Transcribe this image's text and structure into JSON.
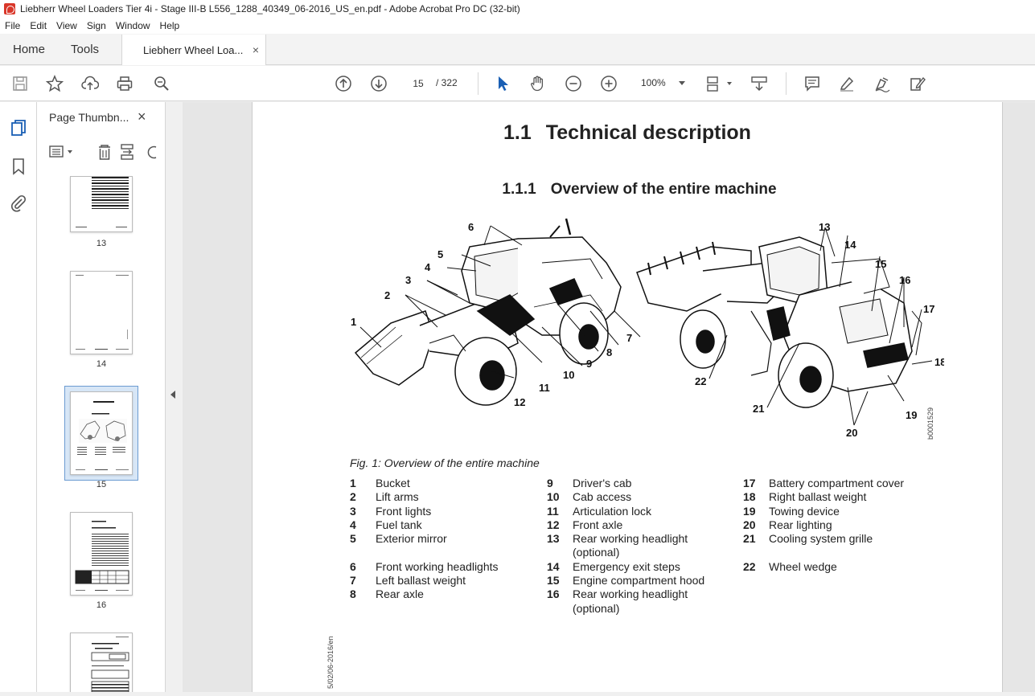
{
  "window": {
    "title": "Liebherr Wheel Loaders Tier 4i - Stage III-B L556_1288_40349_06-2016_US_en.pdf - Adobe Acrobat Pro DC (32-bit)"
  },
  "menu": [
    "File",
    "Edit",
    "View",
    "Sign",
    "Window",
    "Help"
  ],
  "tabs": {
    "home": "Home",
    "tools": "Tools",
    "document": "Liebherr Wheel Loa...",
    "close": "×"
  },
  "toolbar": {
    "current_page": "15",
    "page_count": "/ 322",
    "zoom": "100%"
  },
  "thumbnails_panel": {
    "title": "Page Thumbn...",
    "close": "×",
    "pages": [
      {
        "label": "13"
      },
      {
        "label": "14"
      },
      {
        "label": "15",
        "selected": true
      },
      {
        "label": "16"
      }
    ]
  },
  "document": {
    "heading1_num": "1.1",
    "heading1_text": "Technical description",
    "heading2_num": "1.1.1",
    "heading2_text": "Overview of the entire machine",
    "caption": "Fig. 1: Overview of the entire machine",
    "figure_code": "b0001529",
    "side_text": "5/02/06-2016/en",
    "callouts": [
      "1",
      "2",
      "3",
      "4",
      "5",
      "6",
      "7",
      "8",
      "9",
      "10",
      "11",
      "12",
      "13",
      "14",
      "15",
      "16",
      "17",
      "18",
      "19",
      "20",
      "21",
      "22"
    ],
    "legend": [
      [
        {
          "n": "1",
          "t": "Bucket"
        },
        {
          "n": "2",
          "t": "Lift arms"
        },
        {
          "n": "3",
          "t": "Front lights"
        },
        {
          "n": "4",
          "t": "Fuel tank"
        },
        {
          "n": "5",
          "t": "Exterior mirror"
        },
        {
          "n": "",
          "t": ""
        },
        {
          "n": "6",
          "t": "Front working headlights"
        },
        {
          "n": "7",
          "t": "Left ballast weight"
        },
        {
          "n": "8",
          "t": "Rear axle"
        }
      ],
      [
        {
          "n": "9",
          "t": "Driver's cab"
        },
        {
          "n": "10",
          "t": "Cab access"
        },
        {
          "n": "11",
          "t": "Articulation lock"
        },
        {
          "n": "12",
          "t": "Front axle"
        },
        {
          "n": "13",
          "t": "Rear working headlight"
        },
        {
          "n": "",
          "t": "(optional)"
        },
        {
          "n": "14",
          "t": "Emergency exit steps"
        },
        {
          "n": "15",
          "t": "Engine compartment hood"
        },
        {
          "n": "16",
          "t": "Rear working headlight"
        },
        {
          "n": "",
          "t": "(optional)"
        }
      ],
      [
        {
          "n": "17",
          "t": "Battery compartment cover"
        },
        {
          "n": "18",
          "t": "Right ballast weight"
        },
        {
          "n": "19",
          "t": "Towing device"
        },
        {
          "n": "20",
          "t": "Rear lighting"
        },
        {
          "n": "21",
          "t": "Cooling system grille"
        },
        {
          "n": "",
          "t": ""
        },
        {
          "n": "22",
          "t": "Wheel wedge"
        }
      ]
    ]
  }
}
